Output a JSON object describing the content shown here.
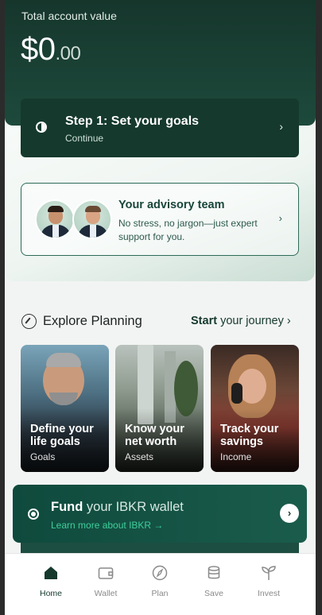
{
  "hero": {
    "label": "Total account value",
    "value_main": "$0",
    "value_cents": ".00"
  },
  "step_card": {
    "title": "Step 1: Set your goals",
    "subtitle": "Continue",
    "icon": "progress-pie-icon"
  },
  "advisory": {
    "title": "Your advisory team",
    "description": "No stress, no jargon—just expert support for you."
  },
  "explore": {
    "title": "Explore Planning",
    "start_bold": "Start",
    "start_rest": " your journey ›",
    "icon": "compass-icon",
    "tiles": [
      {
        "title": "Define your life goals",
        "subtitle": "Goals"
      },
      {
        "title": "Know your net worth",
        "subtitle": "Assets"
      },
      {
        "title": "Track your savings",
        "subtitle": "Income"
      }
    ]
  },
  "fund": {
    "title_bold": "Fund",
    "title_rest": " your IBKR wallet",
    "link": "Learn more about IBKR →",
    "button_icon": "chevron-right-icon"
  },
  "tabs": [
    {
      "label": "Home",
      "icon": "home-icon",
      "active": true
    },
    {
      "label": "Wallet",
      "icon": "wallet-icon",
      "active": false
    },
    {
      "label": "Plan",
      "icon": "compass-icon",
      "active": false
    },
    {
      "label": "Save",
      "icon": "database-icon",
      "active": false
    },
    {
      "label": "Invest",
      "icon": "sprout-icon",
      "active": false
    }
  ],
  "colors": {
    "primary_dark": "#15392d",
    "accent_green": "#3ecf9a",
    "background": "#f2f4f3"
  }
}
